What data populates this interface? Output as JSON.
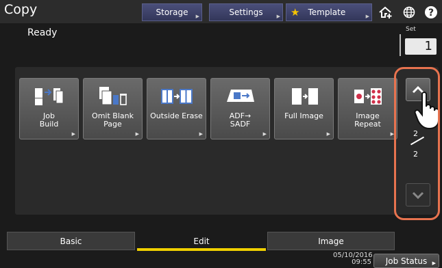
{
  "header": {
    "title": "Copy",
    "storage_label": "Storage",
    "settings_label": "Settings",
    "template_label": "Template"
  },
  "status": {
    "text": "Ready",
    "set_label": "Set",
    "set_value": "1"
  },
  "functions": [
    {
      "label": "Job\nBuild",
      "icon": "job-build-icon"
    },
    {
      "label": "Omit Blank\nPage",
      "icon": "omit-blank-page-icon"
    },
    {
      "label": "Outside Erase",
      "icon": "outside-erase-icon"
    },
    {
      "label": "ADF→\nSADF",
      "icon": "adf-sadf-icon"
    },
    {
      "label": "Full Image",
      "icon": "full-image-icon"
    },
    {
      "label": "Image\nRepeat",
      "icon": "image-repeat-icon"
    }
  ],
  "pager": {
    "current": "2",
    "total": "2"
  },
  "tabs": [
    {
      "label": "Basic"
    },
    {
      "label": "Edit"
    },
    {
      "label": "Image"
    }
  ],
  "footer": {
    "date": "05/10/2016",
    "time": "09:55",
    "job_status_label": "Job Status"
  },
  "colors": {
    "highlight": "#e8734f",
    "active_tab_underline": "#f0d000"
  }
}
